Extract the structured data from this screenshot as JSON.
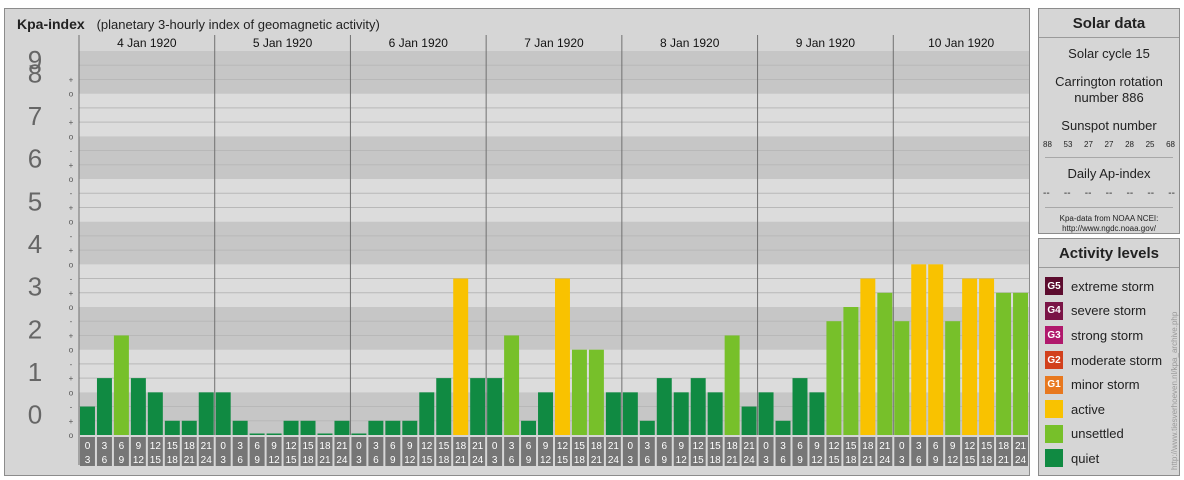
{
  "title": "Kpa-index",
  "subtitle": "(planetary 3-hourly index of geomagnetic activity)",
  "chart_data": {
    "type": "bar",
    "y_label": "",
    "ylim": [
      0,
      9
    ],
    "y_ticks": [
      "0",
      "1",
      "2",
      "3",
      "4",
      "5",
      "6",
      "7",
      "8",
      "9"
    ],
    "sub_ticks": [
      "-",
      "o",
      "+"
    ],
    "days": [
      "4 Jan 1920",
      "5 Jan 1920",
      "6 Jan 1920",
      "7 Jan 1920",
      "8 Jan 1920",
      "9 Jan 1920",
      "10 Jan 1920"
    ],
    "interval_start": [
      "0",
      "3",
      "6",
      "9",
      "12",
      "15",
      "18",
      "21"
    ],
    "interval_end": [
      "3",
      "6",
      "9",
      "12",
      "15",
      "18",
      "21",
      "24"
    ],
    "values": [
      [
        0.667,
        1.333,
        2.333,
        1.333,
        1.0,
        0.333,
        0.333,
        1.0
      ],
      [
        1.0,
        0.333,
        0.0,
        0.0,
        0.333,
        0.333,
        0.0,
        0.333
      ],
      [
        0.0,
        0.333,
        0.333,
        0.333,
        1.0,
        1.333,
        3.667,
        1.333
      ],
      [
        1.333,
        2.333,
        0.333,
        1.0,
        3.667,
        2.0,
        2.0,
        1.0
      ],
      [
        1.0,
        0.333,
        1.333,
        1.0,
        1.333,
        1.0,
        2.333,
        0.667
      ],
      [
        1.0,
        0.333,
        1.333,
        1.0,
        2.667,
        3.0,
        3.667,
        3.333
      ],
      [
        2.667,
        4.0,
        4.0,
        2.667,
        3.667,
        3.667,
        3.333,
        3.333
      ]
    ],
    "colors": {
      "quiet": "#108a42",
      "unsettled": "#77c02a",
      "active": "#f9c200"
    }
  },
  "solar": {
    "title": "Solar data",
    "cycle": "Solar cycle 15",
    "carrington_line1": "Carrington rotation",
    "carrington_line2": "number 886",
    "sunspot_label": "Sunspot number",
    "sunspot_values": [
      "88",
      "53",
      "27",
      "27",
      "28",
      "25",
      "68"
    ],
    "ap_label": "Daily Ap-index",
    "ap_values": [
      "--",
      "--",
      "--",
      "--",
      "--",
      "--",
      "--"
    ],
    "credit_line1": "Kpa-data from NOAA NCEI:",
    "credit_line2": "http://www.ngdc.noaa.gov/"
  },
  "activity": {
    "title": "Activity levels",
    "items": [
      {
        "badge": "G5",
        "label": "extreme storm",
        "color": "#5c0c2e"
      },
      {
        "badge": "G4",
        "label": "severe storm",
        "color": "#7a1446"
      },
      {
        "badge": "G3",
        "label": "strong storm",
        "color": "#b0186c"
      },
      {
        "badge": "G2",
        "label": "moderate storm",
        "color": "#d2401c"
      },
      {
        "badge": "G1",
        "label": "minor storm",
        "color": "#e8781e"
      },
      {
        "badge": "",
        "label": "active",
        "color": "#f9c200"
      },
      {
        "badge": "",
        "label": "unsettled",
        "color": "#77c02a"
      },
      {
        "badge": "",
        "label": "quiet",
        "color": "#108a42"
      }
    ]
  },
  "watermark": "http://www.tiesverhoeven.nl/kpa_archive.php"
}
